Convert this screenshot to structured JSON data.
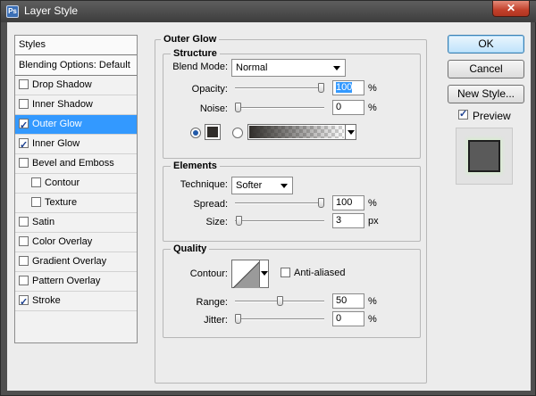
{
  "window": {
    "title": "Layer Style",
    "close_glyph": "✕"
  },
  "sidebar": {
    "header": "Styles",
    "items": [
      {
        "label": "Blending Options: Default",
        "has_checkbox": false,
        "checked": false,
        "selected": false,
        "sub": false
      },
      {
        "label": "Drop Shadow",
        "has_checkbox": true,
        "checked": false,
        "selected": false,
        "sub": false
      },
      {
        "label": "Inner Shadow",
        "has_checkbox": true,
        "checked": false,
        "selected": false,
        "sub": false
      },
      {
        "label": "Outer Glow",
        "has_checkbox": true,
        "checked": true,
        "selected": true,
        "sub": false
      },
      {
        "label": "Inner Glow",
        "has_checkbox": true,
        "checked": true,
        "selected": false,
        "sub": false
      },
      {
        "label": "Bevel and Emboss",
        "has_checkbox": true,
        "checked": false,
        "selected": false,
        "sub": false
      },
      {
        "label": "Contour",
        "has_checkbox": true,
        "checked": false,
        "selected": false,
        "sub": true
      },
      {
        "label": "Texture",
        "has_checkbox": true,
        "checked": false,
        "selected": false,
        "sub": true
      },
      {
        "label": "Satin",
        "has_checkbox": true,
        "checked": false,
        "selected": false,
        "sub": false
      },
      {
        "label": "Color Overlay",
        "has_checkbox": true,
        "checked": false,
        "selected": false,
        "sub": false
      },
      {
        "label": "Gradient Overlay",
        "has_checkbox": true,
        "checked": false,
        "selected": false,
        "sub": false
      },
      {
        "label": "Pattern Overlay",
        "has_checkbox": true,
        "checked": false,
        "selected": false,
        "sub": false
      },
      {
        "label": "Stroke",
        "has_checkbox": true,
        "checked": true,
        "selected": false,
        "sub": false
      }
    ]
  },
  "panel": {
    "title": "Outer Glow",
    "structure": {
      "legend": "Structure",
      "blend_mode_label": "Blend Mode:",
      "blend_mode_value": "Normal",
      "opacity_label": "Opacity:",
      "opacity_value": "100",
      "opacity_unit": "%",
      "opacity_level": 1.0,
      "noise_label": "Noise:",
      "noise_value": "0",
      "noise_unit": "%",
      "noise_level": 0.0,
      "glow_mode": "color",
      "glow_color": "#302d2a"
    },
    "elements": {
      "legend": "Elements",
      "technique_label": "Technique:",
      "technique_value": "Softer",
      "spread_label": "Spread:",
      "spread_value": "100",
      "spread_unit": "%",
      "spread_level": 1.0,
      "size_label": "Size:",
      "size_value": "3",
      "size_unit": "px",
      "size_level": 0.012
    },
    "quality": {
      "legend": "Quality",
      "contour_label": "Contour:",
      "anti_aliased_label": "Anti-aliased",
      "anti_aliased_checked": false,
      "range_label": "Range:",
      "range_value": "50",
      "range_unit": "%",
      "range_level": 0.5,
      "jitter_label": "Jitter:",
      "jitter_value": "0",
      "jitter_unit": "%",
      "jitter_level": 0.0
    }
  },
  "buttons": {
    "ok": "OK",
    "cancel": "Cancel",
    "new_style": "New Style..."
  },
  "preview": {
    "label": "Preview",
    "checked": true
  },
  "colors": {
    "selection": "#3399ff",
    "dialog_bg": "#ececec",
    "glow_swatch": "#302d2a"
  }
}
